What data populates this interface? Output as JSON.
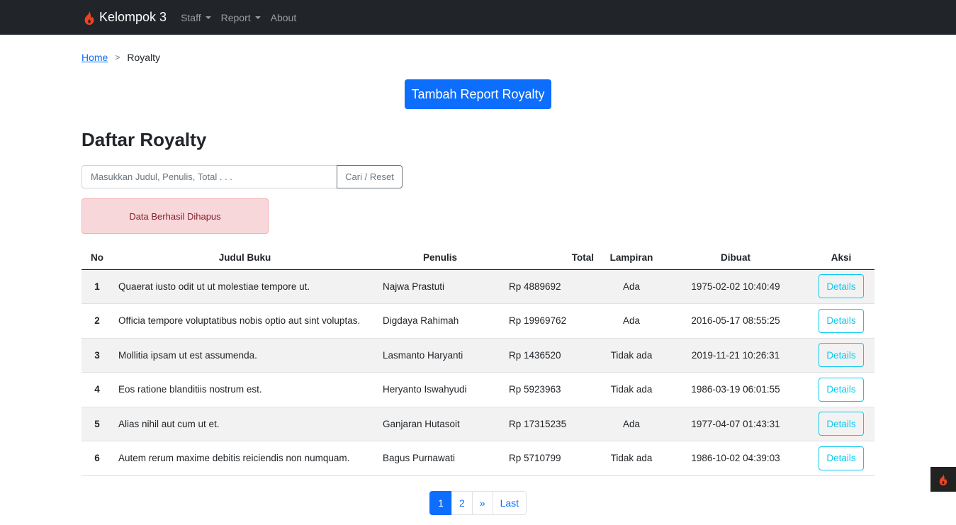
{
  "colors": {
    "navbar_bg": "#212529",
    "primary": "#0d6efd",
    "info": "#0dcaf0",
    "danger_bg": "#f8d7da",
    "danger_text": "#842029",
    "brand_flame": "#ee4323"
  },
  "navbar": {
    "brand": "Kelompok 3",
    "brand_icon": "flame-icon",
    "items": [
      {
        "label": "Staff",
        "dropdown": true
      },
      {
        "label": "Report",
        "dropdown": true
      },
      {
        "label": "About",
        "dropdown": false
      }
    ]
  },
  "breadcrumb": {
    "home": "Home",
    "separator": ">",
    "current": "Royalty"
  },
  "add_button": "Tambah Report Royalty",
  "title": "Daftar Royalty",
  "search": {
    "placeholder": "Masukkan Judul, Penulis, Total . . .",
    "value": "",
    "button": "Cari / Reset"
  },
  "alert": "Data Berhasil Dihapus",
  "table": {
    "headers": [
      "No",
      "Judul Buku",
      "Penulis",
      "Total",
      "Lampiran",
      "Dibuat",
      "Aksi"
    ],
    "rows": [
      {
        "no": "1",
        "judul": "Quaerat iusto odit ut ut molestiae tempore ut.",
        "penulis": "Najwa Prastuti",
        "total": "Rp 4889692",
        "lampiran": "Ada",
        "dibuat": "1975-02-02 10:40:49",
        "aksi": "Details"
      },
      {
        "no": "2",
        "judul": "Officia tempore voluptatibus nobis optio aut sint voluptas.",
        "penulis": "Digdaya Rahimah",
        "total": "Rp 19969762",
        "lampiran": "Ada",
        "dibuat": "2016-05-17 08:55:25",
        "aksi": "Details"
      },
      {
        "no": "3",
        "judul": "Mollitia ipsam ut est assumenda.",
        "penulis": "Lasmanto Haryanti",
        "total": "Rp 1436520",
        "lampiran": "Tidak ada",
        "dibuat": "2019-11-21 10:26:31",
        "aksi": "Details"
      },
      {
        "no": "4",
        "judul": "Eos ratione blanditiis nostrum est.",
        "penulis": "Heryanto Iswahyudi",
        "total": "Rp 5923963",
        "lampiran": "Tidak ada",
        "dibuat": "1986-03-19 06:01:55",
        "aksi": "Details"
      },
      {
        "no": "5",
        "judul": "Alias nihil aut cum ut et.",
        "penulis": "Ganjaran Hutasoit",
        "total": "Rp 17315235",
        "lampiran": "Ada",
        "dibuat": "1977-04-07 01:43:31",
        "aksi": "Details"
      },
      {
        "no": "6",
        "judul": "Autem rerum maxime debitis reiciendis non numquam.",
        "penulis": "Bagus Purnawati",
        "total": "Rp 5710799",
        "lampiran": "Tidak ada",
        "dibuat": "1986-10-02 04:39:03",
        "aksi": "Details"
      }
    ]
  },
  "pagination": {
    "items": [
      "1",
      "2",
      "»",
      "Last"
    ],
    "active": "1"
  },
  "debug_toolbar_icon": "flame-icon"
}
